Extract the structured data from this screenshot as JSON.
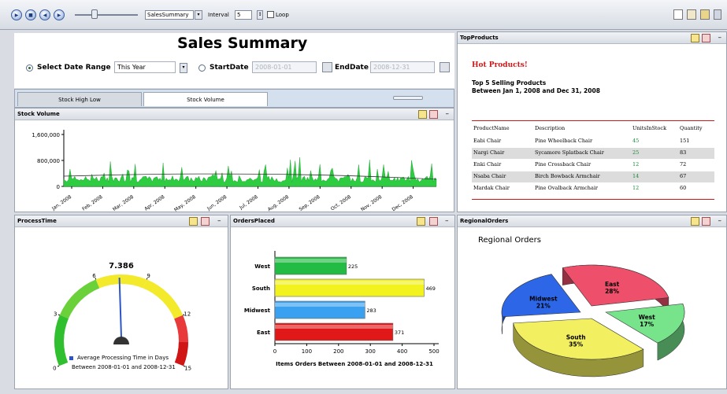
{
  "toolbar": {
    "report": "SalesSummary",
    "interval_label": "Interval",
    "interval_value": "5",
    "loop_label": "Loop"
  },
  "header": {
    "title": "Sales Summary",
    "select_range_label": "Select Date Range",
    "range_value": "This Year",
    "start_label": "StartDate",
    "start_value": "2008-01-01",
    "end_label": "EndDate",
    "end_value": "2008-12-31"
  },
  "tabs": [
    {
      "label": "Stock High Low"
    },
    {
      "label": "Stock Volume"
    }
  ],
  "stock_panel": {
    "title": "Stock Volume"
  },
  "top_products": {
    "panel_title": "TopProducts",
    "hot": "Hot Products!",
    "sub1": "Top 5 Selling Products",
    "sub2": "Between Jan 1, 2008 and Dec 31, 2008",
    "columns": [
      "ProductName",
      "Description",
      "UnitsInStock",
      "Quantity"
    ],
    "rows": [
      [
        "Eabi Chair",
        "Pine Wheelback Chair",
        "45",
        "151"
      ],
      [
        "Nargi Chair",
        "Sycamore Splatback Chair",
        "25",
        "83"
      ],
      [
        "Enki Chair",
        "Pine Crossback Chair",
        "12",
        "72"
      ],
      [
        "Nsaba Chair",
        "Birch Bowback Armchair",
        "14",
        "67"
      ],
      [
        "Mardak Chair",
        "Pine Ovalback Armchair",
        "12",
        "60"
      ]
    ]
  },
  "process_panel": {
    "title": "ProcessTime",
    "legend": "Average Processing Time in Days",
    "legend2": "Between 2008-01-01 and 2008-12-31"
  },
  "orders_panel": {
    "title": "OrdersPlaced"
  },
  "regional_panel": {
    "title": "RegionalOrders"
  },
  "chart_data": [
    {
      "type": "area",
      "title": "Stock Volume",
      "x_ticks": [
        "Jan, 2008",
        "Feb, 2008",
        "Mar, 2008",
        "Apr, 2008",
        "May, 2008",
        "Jun, 2008",
        "Jul, 2008",
        "Aug, 2008",
        "Sep, 2008",
        "Oct, 2008",
        "Nov, 2008",
        "Dec, 2008"
      ],
      "y_ticks": [
        "0",
        "800,000",
        "1,600,000"
      ],
      "ylim": [
        0,
        1600000
      ],
      "color": "#2ecc40"
    },
    {
      "type": "gauge",
      "value": 7.386,
      "value_label": "7.386",
      "min": 0,
      "max": 15,
      "ticks": [
        "0",
        "3",
        "6",
        "9",
        "12",
        "15"
      ],
      "series_name": "Average Processing Time in Days"
    },
    {
      "type": "bar",
      "orientation": "horizontal",
      "categories": [
        "West",
        "South",
        "Midwest",
        "East"
      ],
      "values": [
        225,
        469,
        283,
        371
      ],
      "colors": [
        "#22bb44",
        "#f2f21e",
        "#3aa0f0",
        "#e01818"
      ],
      "x_ticks": [
        "0",
        "100",
        "200",
        "300",
        "400",
        "500"
      ],
      "xlim": [
        0,
        500
      ],
      "xlabel": "Items Orders Between 2008-01-01 and 2008-12-31"
    },
    {
      "type": "pie",
      "title": "Regional Orders",
      "slices": [
        {
          "label": "East",
          "pct": "28%",
          "value": 28,
          "color": "#ee4f6a"
        },
        {
          "label": "West",
          "pct": "17%",
          "value": 17,
          "color": "#77e48c"
        },
        {
          "label": "South",
          "pct": "35%",
          "value": 35,
          "color": "#f2f060"
        },
        {
          "label": "Midwest",
          "pct": "21%",
          "value": 21,
          "color": "#2d66e6"
        }
      ]
    }
  ]
}
